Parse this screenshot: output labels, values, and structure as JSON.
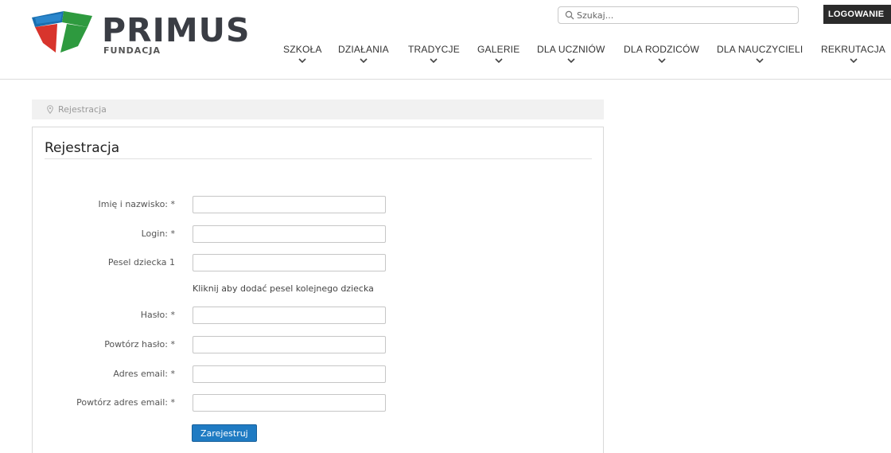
{
  "brand": {
    "name": "PRIMUS",
    "subtitle": "FUNDACJA",
    "colors": {
      "blue": "#1a6fb0",
      "red": "#d8342c",
      "green": "#2e9a3f"
    }
  },
  "search": {
    "placeholder": "Szukaj..."
  },
  "login": {
    "label": "LOGOWANIE"
  },
  "nav": {
    "items": [
      {
        "label": "SZKOŁA"
      },
      {
        "label": "DZIAŁANIA"
      },
      {
        "label": "TRADYCJE"
      },
      {
        "label": "GALERIE"
      },
      {
        "label": "DLA UCZNIÓW"
      },
      {
        "label": "DLA RODZICÓW"
      },
      {
        "label": "DLA NAUCZYCIELI"
      },
      {
        "label": "REKRUTACJA"
      }
    ]
  },
  "breadcrumb": {
    "current": "Rejestracja"
  },
  "form": {
    "title": "Rejestracja",
    "fields": {
      "fullname": {
        "label": "Imię i nazwisko: *",
        "value": ""
      },
      "login": {
        "label": "Login: *",
        "value": ""
      },
      "pesel": {
        "label": "Pesel dziecka 1",
        "value": ""
      },
      "password": {
        "label": "Hasło: *",
        "value": ""
      },
      "password_repeat": {
        "label": "Powtórz hasło: *",
        "value": ""
      },
      "email": {
        "label": "Adres email: *",
        "value": ""
      },
      "email_repeat": {
        "label": "Powtórz adres email: *",
        "value": ""
      }
    },
    "add_pesel_link": "Kliknij aby dodać pesel kolejnego dziecka",
    "submit_label": "Zarejestruj",
    "accent_color": "#1f7bc3"
  }
}
